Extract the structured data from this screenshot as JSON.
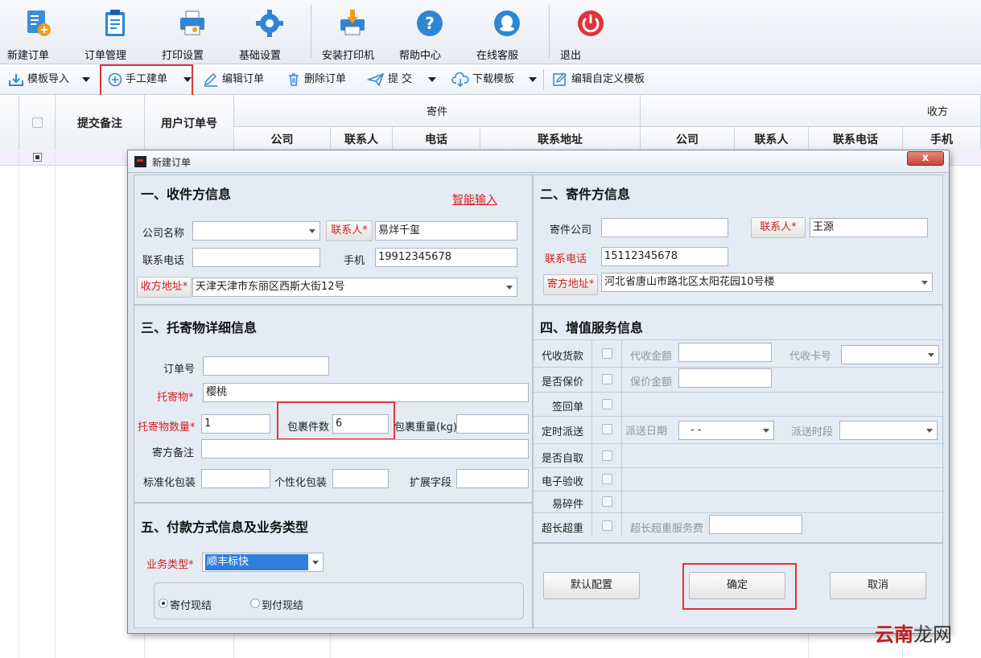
{
  "toolbar": {
    "items": [
      {
        "label": "新建订单",
        "icon": "new-order-icon"
      },
      {
        "label": "订单管理",
        "icon": "clipboard-icon"
      },
      {
        "label": "打印设置",
        "icon": "printer-icon"
      },
      {
        "label": "基础设置",
        "icon": "gear-icon"
      },
      {
        "label": "安装打印机",
        "icon": "install-printer-icon"
      },
      {
        "label": "帮助中心",
        "icon": "help-icon"
      },
      {
        "label": "在线客服",
        "icon": "chat-icon"
      },
      {
        "label": "退出",
        "icon": "power-icon"
      }
    ]
  },
  "toolbar2": {
    "template_import": "模板导入",
    "manual_create": "手工建单",
    "edit_order": "编辑订单",
    "delete_order": "删除订单",
    "submit": "提 交",
    "download_template": "下载模板",
    "edit_custom_template": "编辑自定义模板"
  },
  "grid": {
    "submit_note": "提交备注",
    "user_order_no": "用户订单号",
    "sender_group": "寄件",
    "receiver_group": "收方",
    "sender_cols": [
      "公司",
      "联系人",
      "电话",
      "联系地址"
    ],
    "receiver_cols": [
      "公司",
      "联系人",
      "联系电话",
      "手机"
    ]
  },
  "dialog": {
    "title": "新建订单",
    "close": "x",
    "receiver": {
      "section": "一、收件方信息",
      "smart_input": "智能输入",
      "company_label": "公司名称",
      "company_value": "",
      "contact_label": "联系人*",
      "contact_value": "易烊千玺",
      "phone_label": "联系电话",
      "phone_value": "",
      "mobile_label": "手机",
      "mobile_value": "19912345678",
      "address_label": "收方地址*",
      "address_value": "天津天津市东丽区西斯大街12号"
    },
    "sender": {
      "section": "二、寄件方信息",
      "company_label": "寄件公司",
      "company_value": "",
      "contact_label": "联系人*",
      "contact_value": "王源",
      "phone_label": "联系电话",
      "phone_value": "15112345678",
      "address_label": "寄方地址*",
      "address_value": "河北省唐山市路北区太阳花园10号楼"
    },
    "goods": {
      "section": "三、托寄物详细信息",
      "order_no_label": "订单号",
      "order_no_value": "",
      "item_label": "托寄物*",
      "item_value": "樱桃",
      "qty_label": "托寄物数量*",
      "qty_value": "1",
      "pieces_label": "包裹件数",
      "pieces_value": "6",
      "weight_label": "包裹重量(kg)",
      "weight_value": "",
      "note_label": "寄方备注",
      "note_value": "",
      "std_pack_label": "标准化包装",
      "custom_pack_label": "个性化包装",
      "ext_label": "扩展字段"
    },
    "services": {
      "section": "四、增值服务信息",
      "cod": "代收货款",
      "cod_amount": "代收金额",
      "cod_card": "代收卡号",
      "insured": "是否保价",
      "insured_amount": "保价金额",
      "sign_back": "签回单",
      "scheduled": "定时派送",
      "delivery_date": "派送日期",
      "delivery_date_value": "-  -",
      "delivery_period": "派送时段",
      "self_pickup": "是否自取",
      "e_inspection": "电子验收",
      "fragile": "易碎件",
      "oversize": "超长超重",
      "oversize_fee": "超长超重服务费"
    },
    "payment": {
      "section": "五、付款方式信息及业务类型",
      "biz_type_label": "业务类型*",
      "biz_type_value": "顺丰标快",
      "pay_sender": "寄付现结",
      "pay_receiver": "到付现结"
    },
    "buttons": {
      "default_config": "默认配置",
      "confirm": "确定",
      "cancel": "取消"
    }
  },
  "watermark": {
    "brand": "云南",
    "suffix": "龙网"
  }
}
